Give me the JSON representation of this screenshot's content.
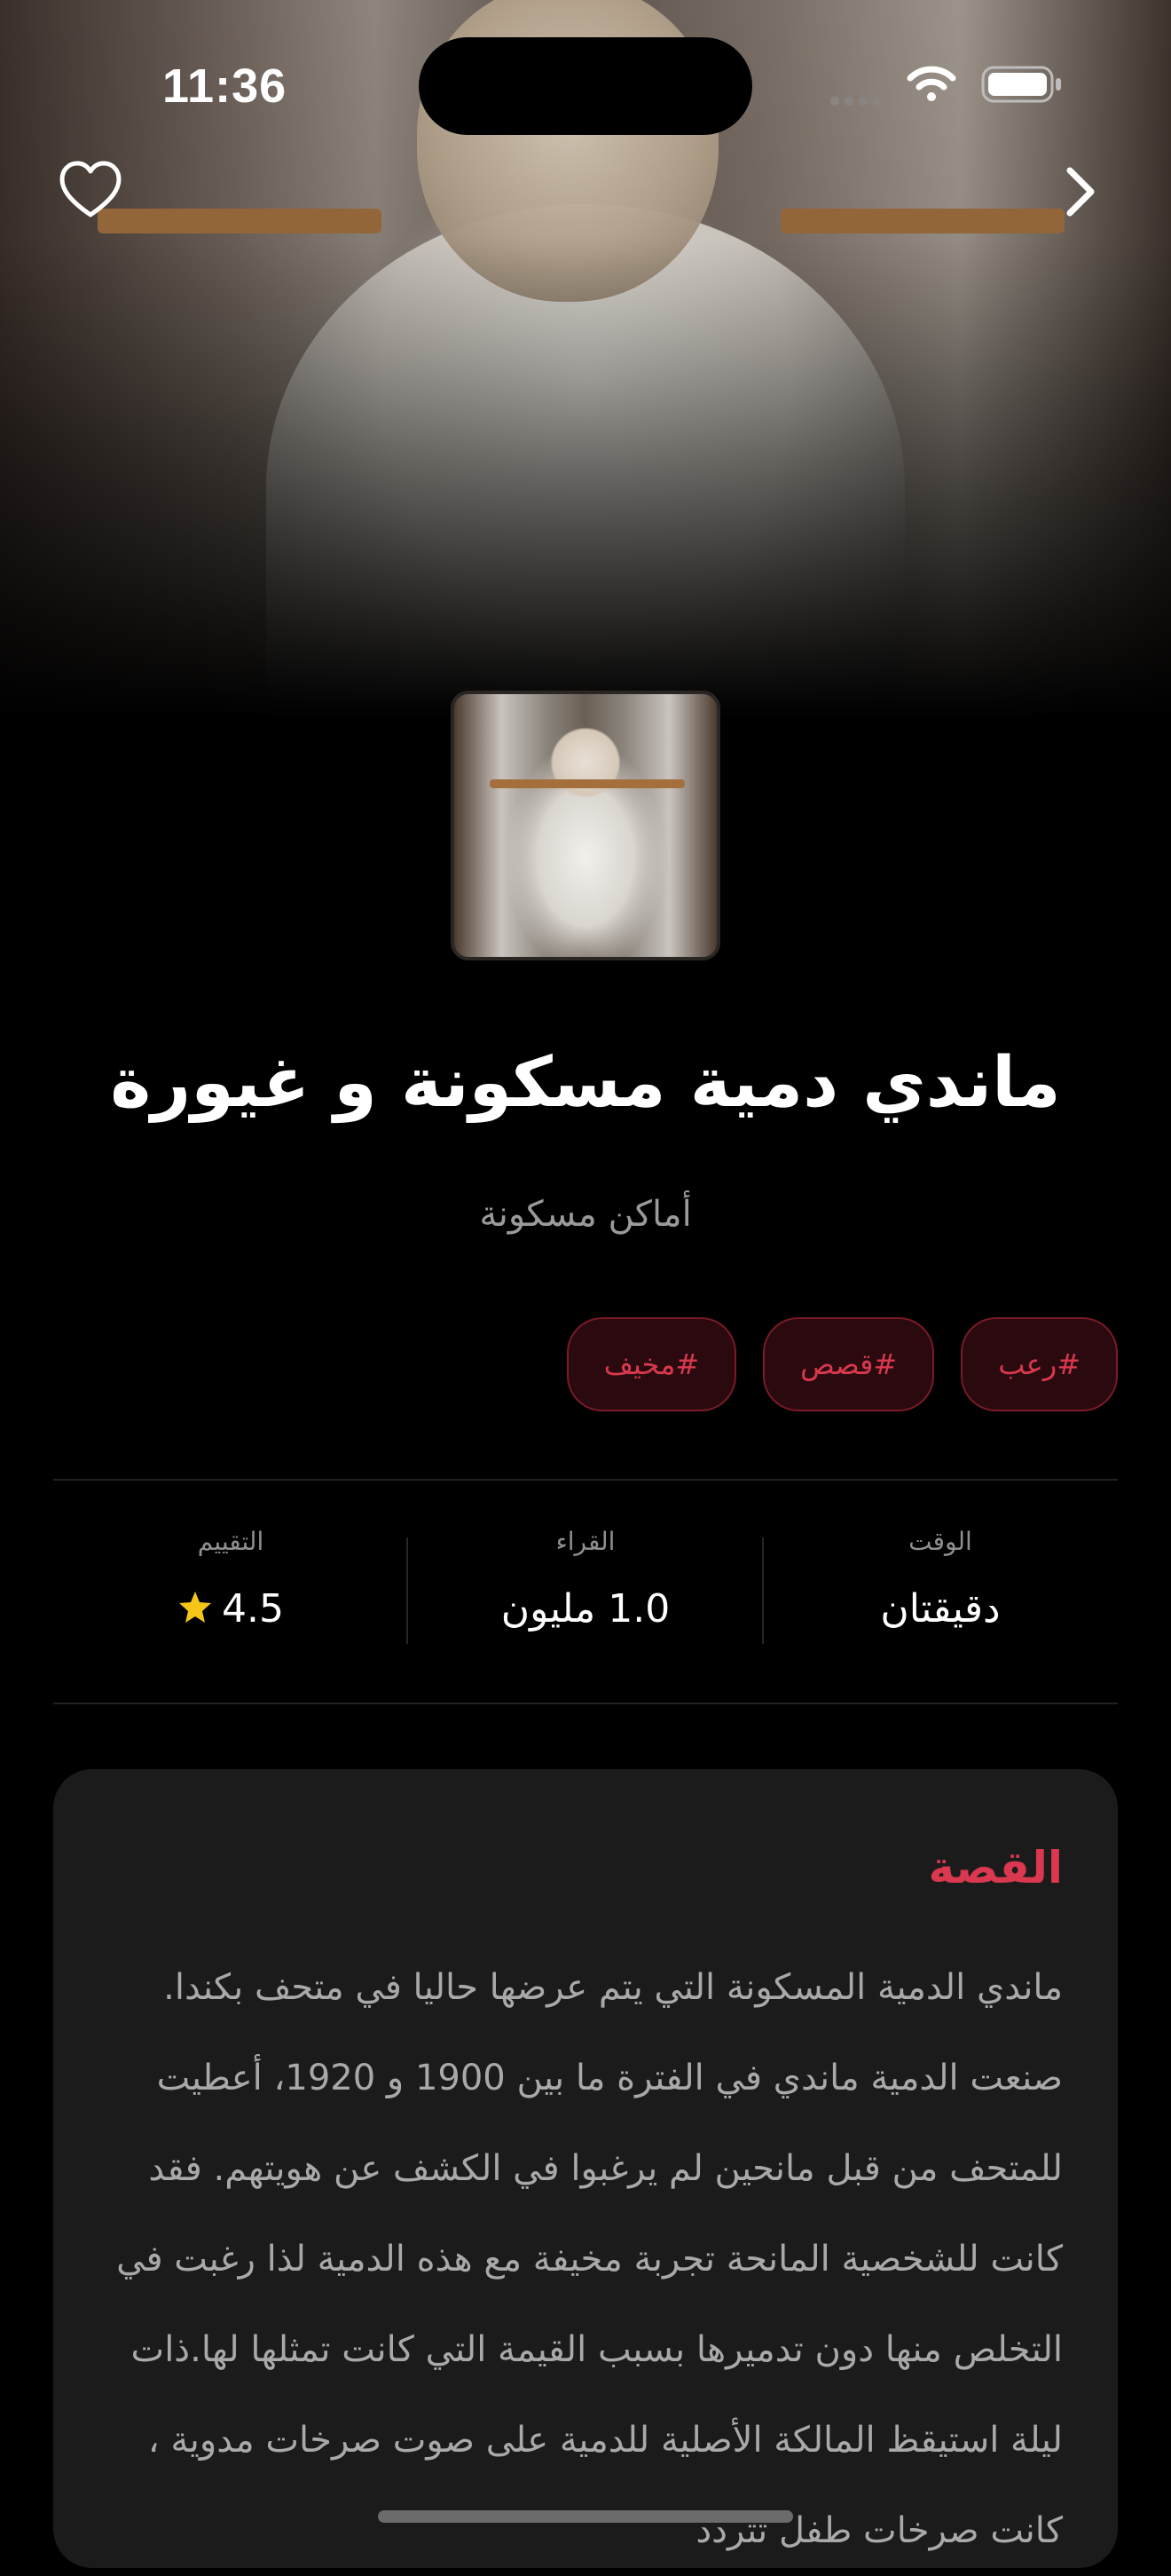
{
  "status_bar": {
    "time": "11:36"
  },
  "header": {
    "favorite_icon": "heart-outline-icon",
    "next_icon": "chevron-right-icon"
  },
  "story": {
    "title": "ماندي دمية مسكونة و غيورة",
    "category": "أماكن مسكونة",
    "tags": [
      "#رعب",
      "#قصص",
      "#مخيف"
    ]
  },
  "stats": {
    "time": {
      "label": "الوقت",
      "value": "دقيقتان"
    },
    "readers": {
      "label": "القراء",
      "value": "1.0 مليون"
    },
    "rating": {
      "label": "التقييم",
      "value": "4.5"
    }
  },
  "card": {
    "title": "القصة",
    "body": "ماندي الدمية المسكونة التي يتم عرضها حاليا في متحف بكندا. صنعت الدمية ماندي في الفترة ما بين 1900 و 1920، أعطيت للمتحف من قبل مانحين لم يرغبوا في الكشف عن هويتهم. فقد كانت للشخصية المانحة تجربة مخيفة مع هذه الدمية لذا رغبت في التخلص منها دون تدميرها بسبب القيمة التي كانت تمثلها لها.ذات ليلة استيقظ المالكة الأصلية للدمية على صوت صرخات مدوية ، كانت صرخات طفل تتردد"
  },
  "colors": {
    "accent": "#d9384e",
    "tag_bg": "#2a0a0f",
    "card_bg": "#1b1b1b",
    "star": "#f5c518"
  }
}
